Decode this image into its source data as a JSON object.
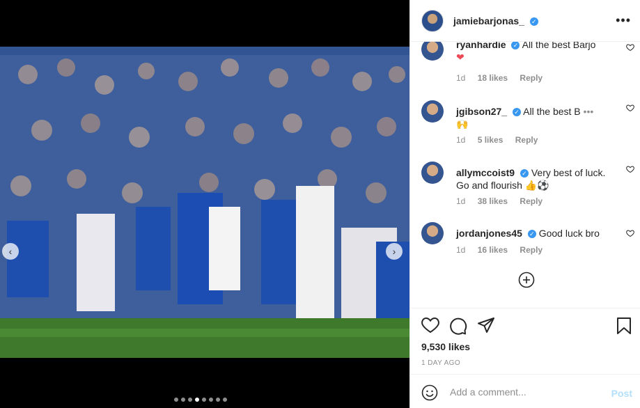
{
  "post": {
    "username": "jamiebarjonas_",
    "more_label": "•••",
    "likes_text": "9,530 likes",
    "ago_text": "1 DAY AGO",
    "carousel": {
      "total": 8,
      "active_index": 3
    }
  },
  "comments": [
    {
      "username": "ryanhardie",
      "text": "All the best Barjo",
      "emoji": "❤",
      "age": "1d",
      "likes": "18 likes",
      "reply": "Reply"
    },
    {
      "username": "jgibson27_",
      "text": "All the best B",
      "emoji": "🙌",
      "age": "1d",
      "likes": "5 likes",
      "reply": "Reply"
    },
    {
      "username": "allymccoist9",
      "text": "Very best of luck. Go and flourish",
      "emoji": "👍⚽",
      "age": "1d",
      "likes": "38 likes",
      "reply": "Reply"
    },
    {
      "username": "jordanjones45",
      "text": "Good luck bro",
      "emoji": "",
      "age": "1d",
      "likes": "16 likes",
      "reply": "Reply"
    }
  ],
  "add_comment": {
    "placeholder": "Add a comment...",
    "post_label": "Post"
  },
  "icons": {
    "like": "heart-icon",
    "comment": "comment-icon",
    "share": "share-icon",
    "save": "bookmark-icon",
    "emoji": "smile-icon",
    "load_more": "plus-circle-icon",
    "verified": "verified-badge-icon",
    "prev": "chevron-left-icon",
    "next": "chevron-right-icon"
  },
  "colors": {
    "verified": "#3897f0",
    "post_button": "#b2dffc",
    "meta": "#8e8e8e",
    "heart_red": "#ed4956"
  }
}
